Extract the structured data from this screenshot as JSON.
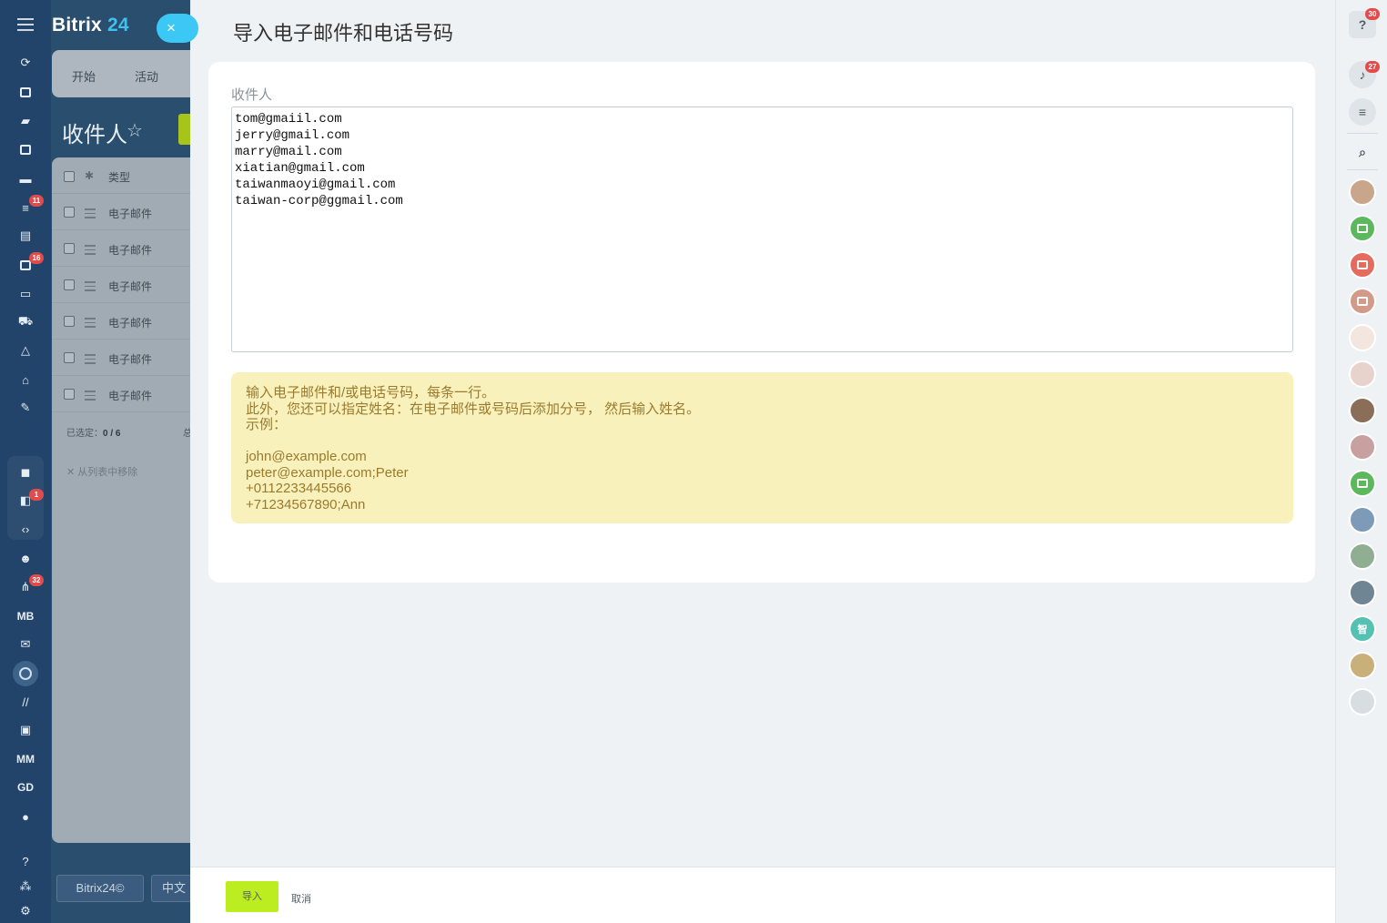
{
  "app": {
    "brand_name": "Bitrix",
    "brand_num": "24",
    "close_icon": "×",
    "tabs": [
      "开始",
      "活动"
    ],
    "page_title": "收件人",
    "star_icon": "☆",
    "list": {
      "header_label": "类型",
      "rows": [
        "电子邮件",
        "电子邮件",
        "电子邮件",
        "电子邮件",
        "电子邮件",
        "电子邮件"
      ],
      "selected_label": "已选定：",
      "selected_value": "0 / 6",
      "total_label": "总",
      "remove_label": "从列表中移除"
    },
    "left_badges": [
      "11",
      "16",
      "1",
      "32"
    ],
    "left_texts": [
      "MB",
      "MM",
      "GD"
    ],
    "footer_brand": "Bitrix24©",
    "footer_lang": "中文"
  },
  "slider": {
    "title": "导入电子邮件和电话号码",
    "field_label": "收件人",
    "recipients_value": "tom@gmaiil.com\njerry@gmail.com\nmarry@mail.com\nxiatian@gmail.com\ntaiwanmaoyi@gmail.com\ntaiwan-corp@ggmail.com",
    "hint_lines": [
      "输入电子邮件和/或电话号码，每条一行。",
      "此外，您还可以指定姓名：在电子邮件或号码后添加分号， 然后输入姓名。",
      "示例：",
      "",
      "john@example.com",
      "peter@example.com;Peter",
      "+0112233445566",
      "+71234567890;Ann"
    ],
    "import_label": "导入",
    "cancel_label": "取消"
  },
  "rightbar": {
    "help_badge": "30",
    "notify_badge": "27",
    "avatar_text": "智"
  },
  "colors": {
    "accent_green": "#bbed21",
    "hint_bg": "#f8f1bc",
    "hint_text": "#9b7a2c",
    "brand_blue": "#3bc8f5",
    "badge_red": "#e24b4b"
  }
}
